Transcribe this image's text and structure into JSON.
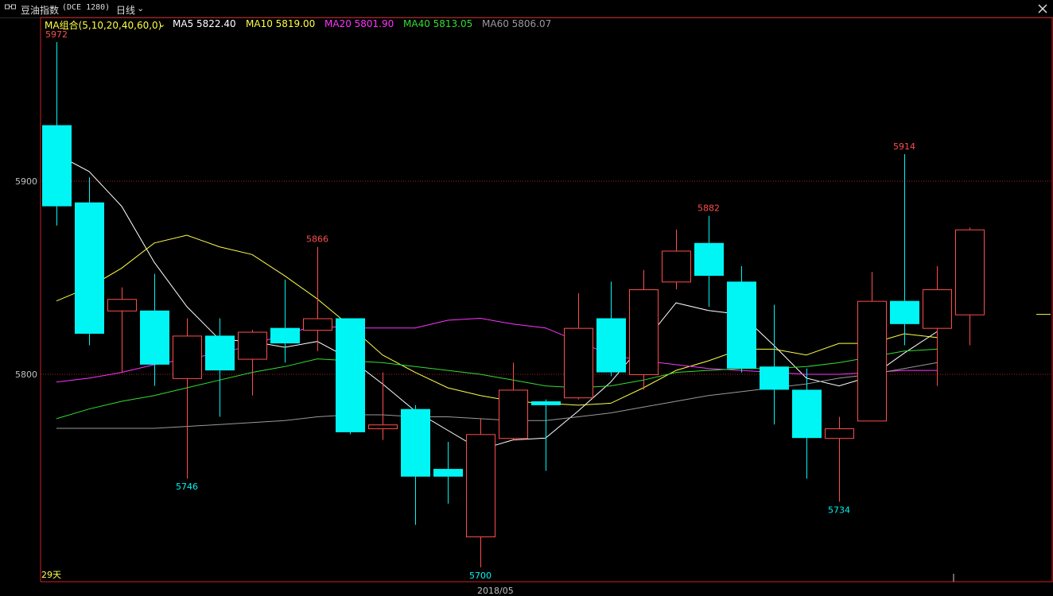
{
  "header": {
    "instrument_name": "豆油指数",
    "instrument_code": "(DCE 1280)",
    "period": "日线"
  },
  "ma_bar": {
    "group_label": "MA组合(5,10,20,40,60,0)",
    "items": [
      {
        "label": "MA5 5822.40",
        "color": "#ffffff"
      },
      {
        "label": "MA10 5819.00",
        "color": "#ffff44"
      },
      {
        "label": "MA20 5801.90",
        "color": "#ff33ff"
      },
      {
        "label": "MA40 5813.05",
        "color": "#33dd33"
      },
      {
        "label": "MA60 5806.07",
        "color": "#9a9a9a"
      }
    ]
  },
  "footer": {
    "days_label": "29天",
    "date_label": "2018/05"
  },
  "colors": {
    "up": "#ff4d4d",
    "down": "#00f5f5",
    "axis": "#cc2222",
    "grid": "#aa2222"
  },
  "chart_data": {
    "type": "candlestick",
    "title": "",
    "y_ticks": [
      5800,
      5900
    ],
    "ylim": [
      5698,
      5975
    ],
    "grid": "horizontal dotted lines at y ticks",
    "candles": [
      {
        "open": 5929,
        "high": 5972,
        "low": 5877,
        "close": 5887
      },
      {
        "open": 5889,
        "high": 5902,
        "low": 5815,
        "close": 5821
      },
      {
        "open": 5833,
        "high": 5845,
        "low": 5801,
        "close": 5839
      },
      {
        "open": 5833,
        "high": 5852,
        "low": 5794,
        "close": 5805
      },
      {
        "open": 5798,
        "high": 5829,
        "low": 5746,
        "close": 5820
      },
      {
        "open": 5820,
        "high": 5829,
        "low": 5778,
        "close": 5802
      },
      {
        "open": 5808,
        "high": 5823,
        "low": 5789,
        "close": 5822
      },
      {
        "open": 5824,
        "high": 5849,
        "low": 5806,
        "close": 5816
      },
      {
        "open": 5823,
        "high": 5866,
        "low": 5812,
        "close": 5829
      },
      {
        "open": 5829,
        "high": 5829,
        "low": 5769,
        "close": 5770
      },
      {
        "open": 5772,
        "high": 5801,
        "low": 5766,
        "close": 5774
      },
      {
        "open": 5782,
        "high": 5784,
        "low": 5722,
        "close": 5747
      },
      {
        "open": 5751,
        "high": 5765,
        "low": 5733,
        "close": 5747
      },
      {
        "open": 5716,
        "high": 5777,
        "low": 5700,
        "close": 5769
      },
      {
        "open": 5767,
        "high": 5806,
        "low": 5766,
        "close": 5792
      },
      {
        "open": 5786,
        "high": 5787,
        "low": 5750,
        "close": 5784
      },
      {
        "open": 5788,
        "high": 5842,
        "low": 5787,
        "close": 5824
      },
      {
        "open": 5829,
        "high": 5848,
        "low": 5799,
        "close": 5801
      },
      {
        "open": 5800,
        "high": 5854,
        "low": 5792,
        "close": 5844
      },
      {
        "open": 5848,
        "high": 5875,
        "low": 5844,
        "close": 5864
      },
      {
        "open": 5868,
        "high": 5882,
        "low": 5835,
        "close": 5851
      },
      {
        "open": 5848,
        "high": 5856,
        "low": 5801,
        "close": 5803
      },
      {
        "open": 5804,
        "high": 5836,
        "low": 5774,
        "close": 5792
      },
      {
        "open": 5792,
        "high": 5803,
        "low": 5746,
        "close": 5767
      },
      {
        "open": 5767,
        "high": 5778,
        "low": 5734,
        "close": 5772
      },
      {
        "open": 5776,
        "high": 5853,
        "low": 5776,
        "close": 5838
      },
      {
        "open": 5838,
        "high": 5914,
        "low": 5815,
        "close": 5826
      },
      {
        "open": 5824,
        "high": 5856,
        "low": 5794,
        "close": 5844
      },
      {
        "open": 5831,
        "high": 5876,
        "low": 5815,
        "close": 5875
      }
    ],
    "ma_series": [
      {
        "name": "MA5",
        "color": "#ffffff",
        "values": [
          5914,
          5905,
          5887,
          5858,
          5835,
          5818,
          5817,
          5814,
          5817,
          5808,
          5795,
          5781,
          5771,
          5761,
          5766,
          5767,
          5781,
          5796,
          5816,
          5837,
          5833,
          5831,
          5815,
          5798,
          5794,
          5799,
          5811,
          5822
        ]
      },
      {
        "name": "MA10",
        "color": "#ffff44",
        "values": [
          5838,
          5845,
          5855,
          5868,
          5872,
          5866,
          5862,
          5851,
          5839,
          5825,
          5810,
          5801,
          5793,
          5789,
          5786,
          5785,
          5784,
          5785,
          5793,
          5802,
          5807,
          5813,
          5813,
          5810,
          5816,
          5816,
          5821,
          5819
        ]
      },
      {
        "name": "MA20",
        "color": "#ff33ff",
        "values": [
          5796,
          5798,
          5801,
          5805,
          5808,
          5811,
          5815,
          5821,
          5825,
          5824,
          5824,
          5824,
          5828,
          5829,
          5826,
          5824,
          5817,
          5810,
          5807,
          5805,
          5803,
          5802,
          5801,
          5800,
          5800,
          5801,
          5802,
          5802
        ]
      },
      {
        "name": "MA40",
        "color": "#33dd33",
        "values": [
          5777,
          5782,
          5786,
          5789,
          5793,
          5797,
          5801,
          5804,
          5808,
          5807,
          5806,
          5804,
          5802,
          5800,
          5797,
          5794,
          5793,
          5794,
          5797,
          5801,
          5802,
          5803,
          5803,
          5804,
          5806,
          5809,
          5812,
          5813
        ]
      },
      {
        "name": "MA60",
        "color": "#9a9a9a",
        "values": [
          5772,
          5772,
          5772,
          5772,
          5773,
          5774,
          5775,
          5776,
          5778,
          5779,
          5779,
          5778,
          5778,
          5777,
          5776,
          5776,
          5778,
          5780,
          5783,
          5786,
          5789,
          5791,
          5793,
          5795,
          5798,
          5800,
          5803,
          5806
        ]
      }
    ],
    "annotations": [
      {
        "candle": 0,
        "value": 5972,
        "label": "5972",
        "pos": "high"
      },
      {
        "candle": 4,
        "value": 5746,
        "label": "5746",
        "pos": "low"
      },
      {
        "candle": 8,
        "value": 5866,
        "label": "5866",
        "pos": "high"
      },
      {
        "candle": 13,
        "value": 5700,
        "label": "5700",
        "pos": "low"
      },
      {
        "candle": 20,
        "value": 5882,
        "label": "5882",
        "pos": "high"
      },
      {
        "candle": 24,
        "value": 5734,
        "label": "5734",
        "pos": "low"
      },
      {
        "candle": 26,
        "value": 5914,
        "label": "5914",
        "pos": "high"
      }
    ],
    "last_close_marker": 5831
  }
}
